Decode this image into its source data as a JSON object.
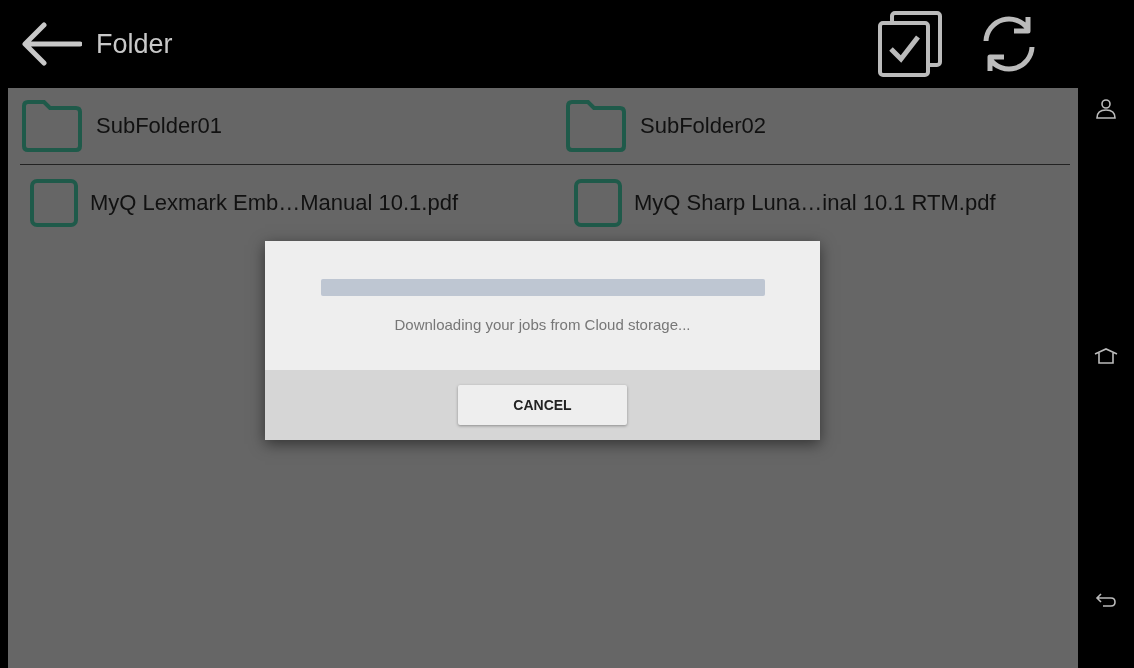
{
  "header": {
    "title": "Folder"
  },
  "items": [
    {
      "kind": "folder",
      "name": "SubFolder01"
    },
    {
      "kind": "folder",
      "name": "SubFolder02"
    },
    {
      "kind": "file",
      "name": "MyQ Lexmark Emb…Manual 10.1.pdf",
      "checked": false
    },
    {
      "kind": "file",
      "name": "MyQ Sharp Luna…inal 10.1 RTM.pdf",
      "checked": false
    }
  ],
  "dialog": {
    "level": 1,
    "message": "Downloading your jobs from Cloud storage...",
    "button": "CANCEL"
  }
}
